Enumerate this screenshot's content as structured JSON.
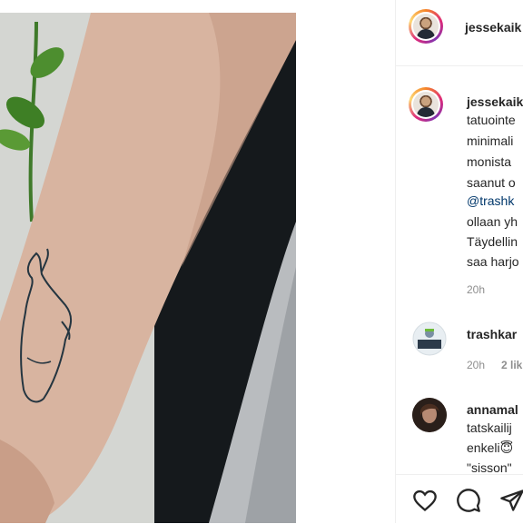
{
  "post": {
    "username": "jessekaik",
    "caption_username": "jessekaik",
    "caption_lines": [
      "tatuointe",
      "minimali",
      "monista",
      "saanut o"
    ],
    "caption_mention": "@trashk",
    "caption_lines_after": [
      "ollaan yh",
      "Täydellin",
      "saa harjo"
    ],
    "caption_time": "20h"
  },
  "comments": [
    {
      "username": "trashkar",
      "time": "20h",
      "likes": "2 lik"
    },
    {
      "username": "annamal",
      "lines": [
        "tatskailij",
        "enkeli😇",
        "\"sisson\""
      ]
    }
  ],
  "actions": {
    "icons": [
      "heart-icon",
      "comment-icon",
      "share-icon"
    ]
  },
  "colors": {
    "mention": "#00376b",
    "meta": "#8e8e8e",
    "story_ring": "#dd2a7b"
  }
}
